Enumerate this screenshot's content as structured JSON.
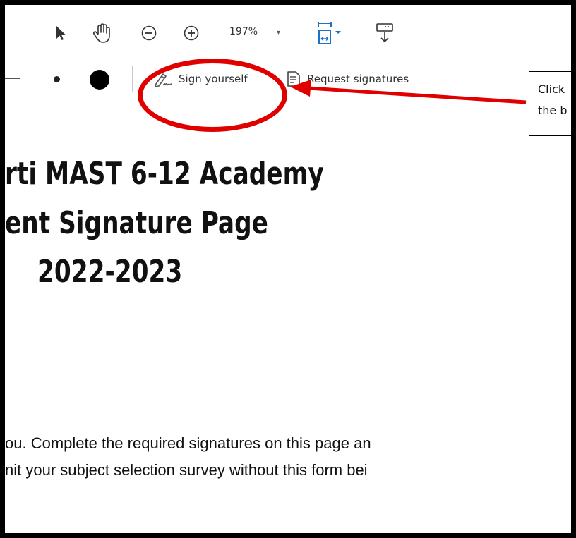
{
  "toolbar": {
    "zoom_value": "197%",
    "zoom_caret": "▾"
  },
  "sign_toolbar": {
    "sign_label": "Sign yourself",
    "request_label": "Request signatures"
  },
  "document": {
    "title_lines": [
      "rti MAST 6-12 Academy",
      "ent Signature Page",
      "2022-2023"
    ],
    "body_lines": [
      "ou. Complete the required signatures on this page an",
      "nit your subject selection survey without this form bei"
    ]
  },
  "annotation": {
    "callout_lines": [
      "Click",
      "the b"
    ],
    "highlight_color": "#e00000",
    "arrow_color": "#e00000"
  },
  "colors": {
    "border": "#000000",
    "toolbar_bg": "#ffffff",
    "accent_blue": "#1a73c8"
  }
}
